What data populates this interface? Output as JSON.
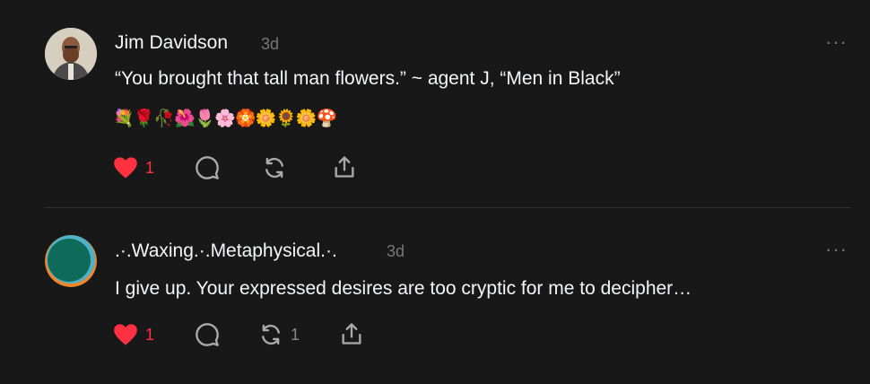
{
  "posts": [
    {
      "author": "Jim Davidson",
      "time": "3d",
      "text": "“You brought that tall man flowers.” ~ agent J, “Men in Black”",
      "emoji": "💐🌹🥀🌺🌷🌸🏵️🌼🌻🌼🍄",
      "likes": "1",
      "reposts": ""
    },
    {
      "author": ".·.Waxing.·.Metaphysical.·.",
      "time": "3d",
      "text": "I give up. Your expressed desires are too cryptic for me to decipher…",
      "likes": "1",
      "reposts": "1"
    }
  ],
  "icons": {
    "like": "heart-icon",
    "reply": "comment-icon",
    "repost": "repost-icon",
    "share": "share-icon",
    "more": "more-icon"
  },
  "colors": {
    "background": "#181818",
    "like_active": "#ff3040",
    "muted": "#777777",
    "text": "#f3f5f7"
  }
}
